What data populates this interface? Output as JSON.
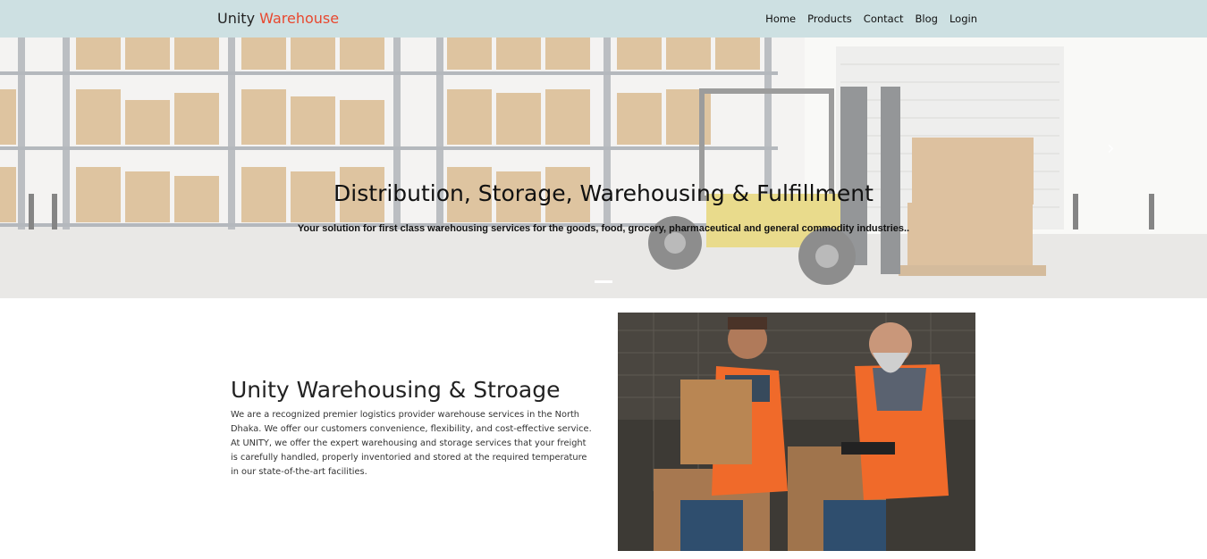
{
  "navbar": {
    "brand_main": "Unity",
    "brand_accent": "Warehouse",
    "links": [
      "Home",
      "Products",
      "Contact",
      "Blog",
      "Login"
    ]
  },
  "hero": {
    "title": "Distribution, Storage, Warehousing & Fulfillment",
    "subtitle": "Your solution for first class warehousing services for the goods, food, grocery, pharmaceutical and general commodity industries..",
    "next_icon": "chevron-right-icon",
    "indicator_count": 1,
    "active_indicator": 1
  },
  "about": {
    "title": "Unity Warehousing & Stroage",
    "text": "We are a recognized premier logistics provider warehouse services in the North Dhaka. We offer our customers convenience, flexibility, and cost-effective service. At UNITY, we offer the expert warehousing and storage services that your freight is carefully handled, properly inventoried and stored at the required temperature in our state-of-the-art facilities."
  },
  "colors": {
    "navbar_bg": "#cde0e2",
    "brand_accent": "#e8482f",
    "forklift": "#d9c23a"
  }
}
